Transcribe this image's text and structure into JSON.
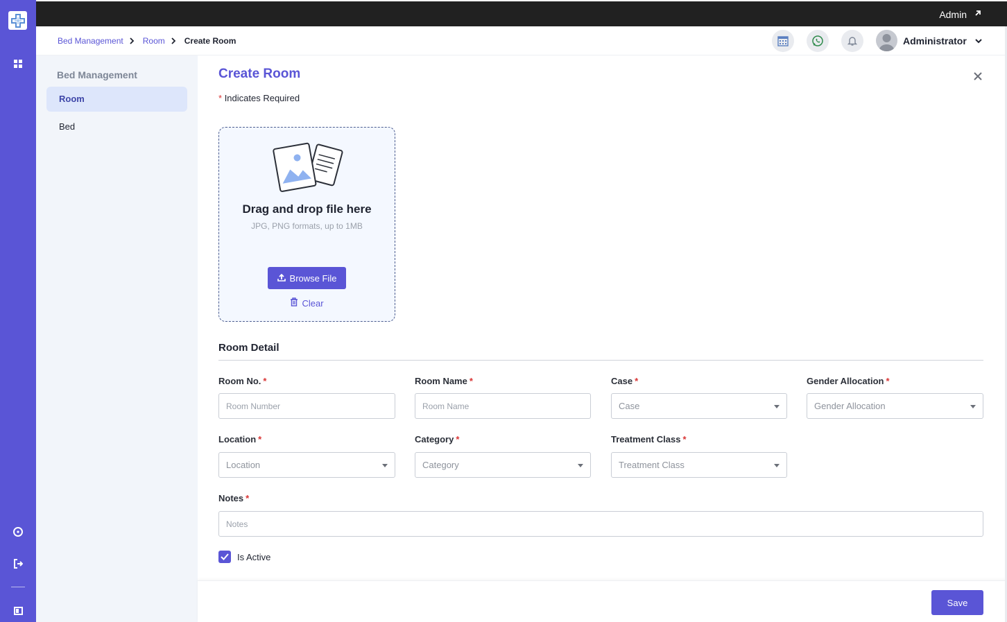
{
  "colors": {
    "accent": "#5a55d6",
    "topbar": "#212121",
    "required": "#d93535",
    "subnav_bg": "#f2f5fa",
    "active_item_bg": "#dde6fb"
  },
  "topbar": {
    "user_label": "Admin"
  },
  "rail": {
    "icons": [
      "app-logo-icon",
      "dashboard-grid-icon",
      "help-icon",
      "logout-icon",
      "collapse-panel-icon"
    ]
  },
  "breadcrumb": {
    "items": [
      "Bed Management",
      "Room"
    ],
    "current": "Create Room"
  },
  "header": {
    "icons": [
      "calendar-icon",
      "whatsapp-icon",
      "bell-icon"
    ],
    "username": "Administrator"
  },
  "subnav": {
    "title": "Bed Management",
    "items": [
      {
        "label": "Room",
        "active": true
      },
      {
        "label": "Bed",
        "active": false
      }
    ]
  },
  "form": {
    "title": "Create Room",
    "required_star": "*",
    "required_note": "Indicates Required",
    "upload": {
      "title": "Drag and drop file here",
      "subtitle": "JPG, PNG formats, up to 1MB",
      "browse_label": "Browse File",
      "clear_label": "Clear"
    },
    "section_title": "Room Detail",
    "fields": {
      "room_no": {
        "label": "Room No.",
        "placeholder": "Room Number",
        "value": ""
      },
      "room_name": {
        "label": "Room Name",
        "placeholder": "Room Name",
        "value": ""
      },
      "case": {
        "label": "Case",
        "placeholder": "Case"
      },
      "gender_allocation": {
        "label": "Gender Allocation",
        "placeholder": "Gender Allocation"
      },
      "location": {
        "label": "Location",
        "placeholder": "Location"
      },
      "category": {
        "label": "Category",
        "placeholder": "Category"
      },
      "treatment_class": {
        "label": "Treatment Class",
        "placeholder": "Treatment Class"
      },
      "notes": {
        "label": "Notes",
        "placeholder": "Notes",
        "value": ""
      }
    },
    "is_active": {
      "label": "Is Active",
      "checked": true
    },
    "save_label": "Save"
  }
}
